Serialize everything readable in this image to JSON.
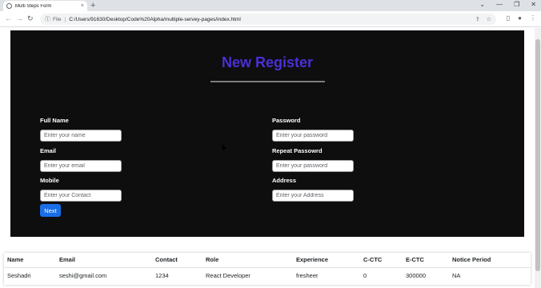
{
  "browser": {
    "tab_title": "Multi Steps Form",
    "tab_close": "×",
    "new_tab": "+",
    "url_protocol": "File",
    "url_separator": "|",
    "url": "C:/Users/91630/Desktop/Code%20Alpha/multiple-servey-pages/index.html",
    "icons": [
      "favicon-icon",
      "back-icon",
      "forward-icon",
      "reload-icon",
      "info-icon",
      "share-icon",
      "star-icon",
      "sidebar-icon",
      "profile-icon",
      "menu-icon"
    ]
  },
  "form": {
    "title": "New Register",
    "title_color": "#4b2fd6",
    "panel_color": "#0f0e0e",
    "fields_left": [
      {
        "label": "Full Name",
        "placeholder": "Enter your name"
      },
      {
        "label": "Email",
        "placeholder": "Enter your email"
      },
      {
        "label": "Mobile",
        "placeholder": "Enter your Contact"
      }
    ],
    "fields_right": [
      {
        "label": "Password",
        "placeholder": "Enter your password"
      },
      {
        "label": "Repeat Passowrd",
        "placeholder": "Enter your password"
      },
      {
        "label": "Address",
        "placeholder": "Enter your Address"
      }
    ],
    "next_label": "Next",
    "next_color": "#1a6fe8"
  },
  "table": {
    "headers": [
      "Name",
      "Email",
      "Contact",
      "Role",
      "Experience",
      "C-CTC",
      "E-CTC",
      "Notice Period"
    ],
    "rows": [
      [
        "Seshadri",
        "seshi@gmail.com",
        "1234",
        "React Developer",
        "fresheer",
        "0",
        "300000",
        "NA"
      ]
    ]
  }
}
